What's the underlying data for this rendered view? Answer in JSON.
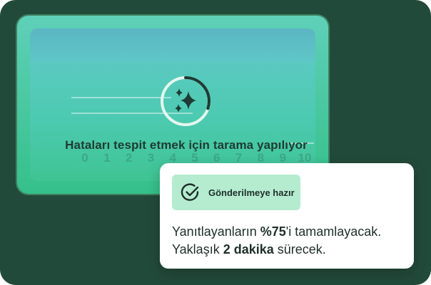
{
  "scan": {
    "title": "Hataları tespit etmek için tarama yapılıyor",
    "icon": "sparkles-icon",
    "progress": 0.3,
    "scale": [
      "0",
      "1",
      "2",
      "3",
      "4",
      "5",
      "6",
      "7",
      "8",
      "9",
      "10"
    ]
  },
  "ready": {
    "badge_icon": "check-circle-icon",
    "badge_label": "Gönderilmeye hazır",
    "line1_prefix": "Yanıtlayanların ",
    "line1_value": "%75",
    "line1_suffix": "'i tamamlayacak.",
    "line2_prefix": "Yaklaşık ",
    "line2_value": "2 dakika",
    "line2_suffix": " sürecek."
  },
  "colors": {
    "background": "#224a3a",
    "scan_card": "#3fc493",
    "badge": "#b5ecd0",
    "text_dark": "#1f2f2a"
  }
}
